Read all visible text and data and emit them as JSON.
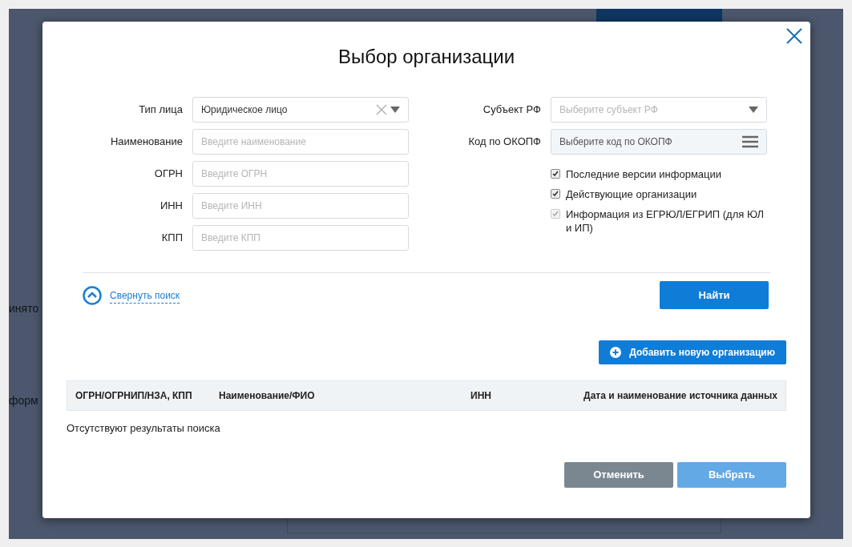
{
  "background": {
    "fragment_1": "инято",
    "fragment_2": "форм"
  },
  "dialog": {
    "title": "Выбор организации",
    "left_fields": [
      {
        "label": "Тип лица",
        "kind": "select",
        "value": "Юридическое лицо",
        "clearable": true
      },
      {
        "label": "Наименование",
        "kind": "input",
        "placeholder": "Введите наименование"
      },
      {
        "label": "ОГРН",
        "kind": "input",
        "placeholder": "Введите ОГРН"
      },
      {
        "label": "ИНН",
        "kind": "input",
        "placeholder": "Введите ИНН"
      },
      {
        "label": "КПП",
        "kind": "input",
        "placeholder": "Введите КПП"
      }
    ],
    "right_fields": [
      {
        "label": "Субъект РФ",
        "kind": "select",
        "placeholder": "Выберите субъект РФ"
      },
      {
        "label": "Код по ОКОПФ",
        "kind": "list",
        "placeholder": "Выберите код по ОКОПФ"
      }
    ],
    "checkboxes": [
      {
        "label": "Последние версии информации",
        "checked": true,
        "disabled": false
      },
      {
        "label": "Действующие организации",
        "checked": true,
        "disabled": false
      },
      {
        "label": "Информация из ЕГРЮЛ/ЕГРИП (для ЮЛ и ИП)",
        "checked": true,
        "disabled": true
      }
    ],
    "collapse_link": "Свернуть поиск",
    "find_button": "Найти",
    "add_button": "Добавить новую организацию",
    "table": {
      "columns": [
        "ОГРН/ОГРНИП/НЗА, КПП",
        "Наименование/ФИО",
        "ИНН",
        "Дата и наименование источника данных"
      ],
      "empty_text": "Отсутствуют результаты поиска"
    },
    "buttons": [
      {
        "label": "Отменить",
        "kind": "secondary"
      },
      {
        "label": "Выбрать",
        "kind": "primary",
        "disabled": true
      }
    ]
  }
}
